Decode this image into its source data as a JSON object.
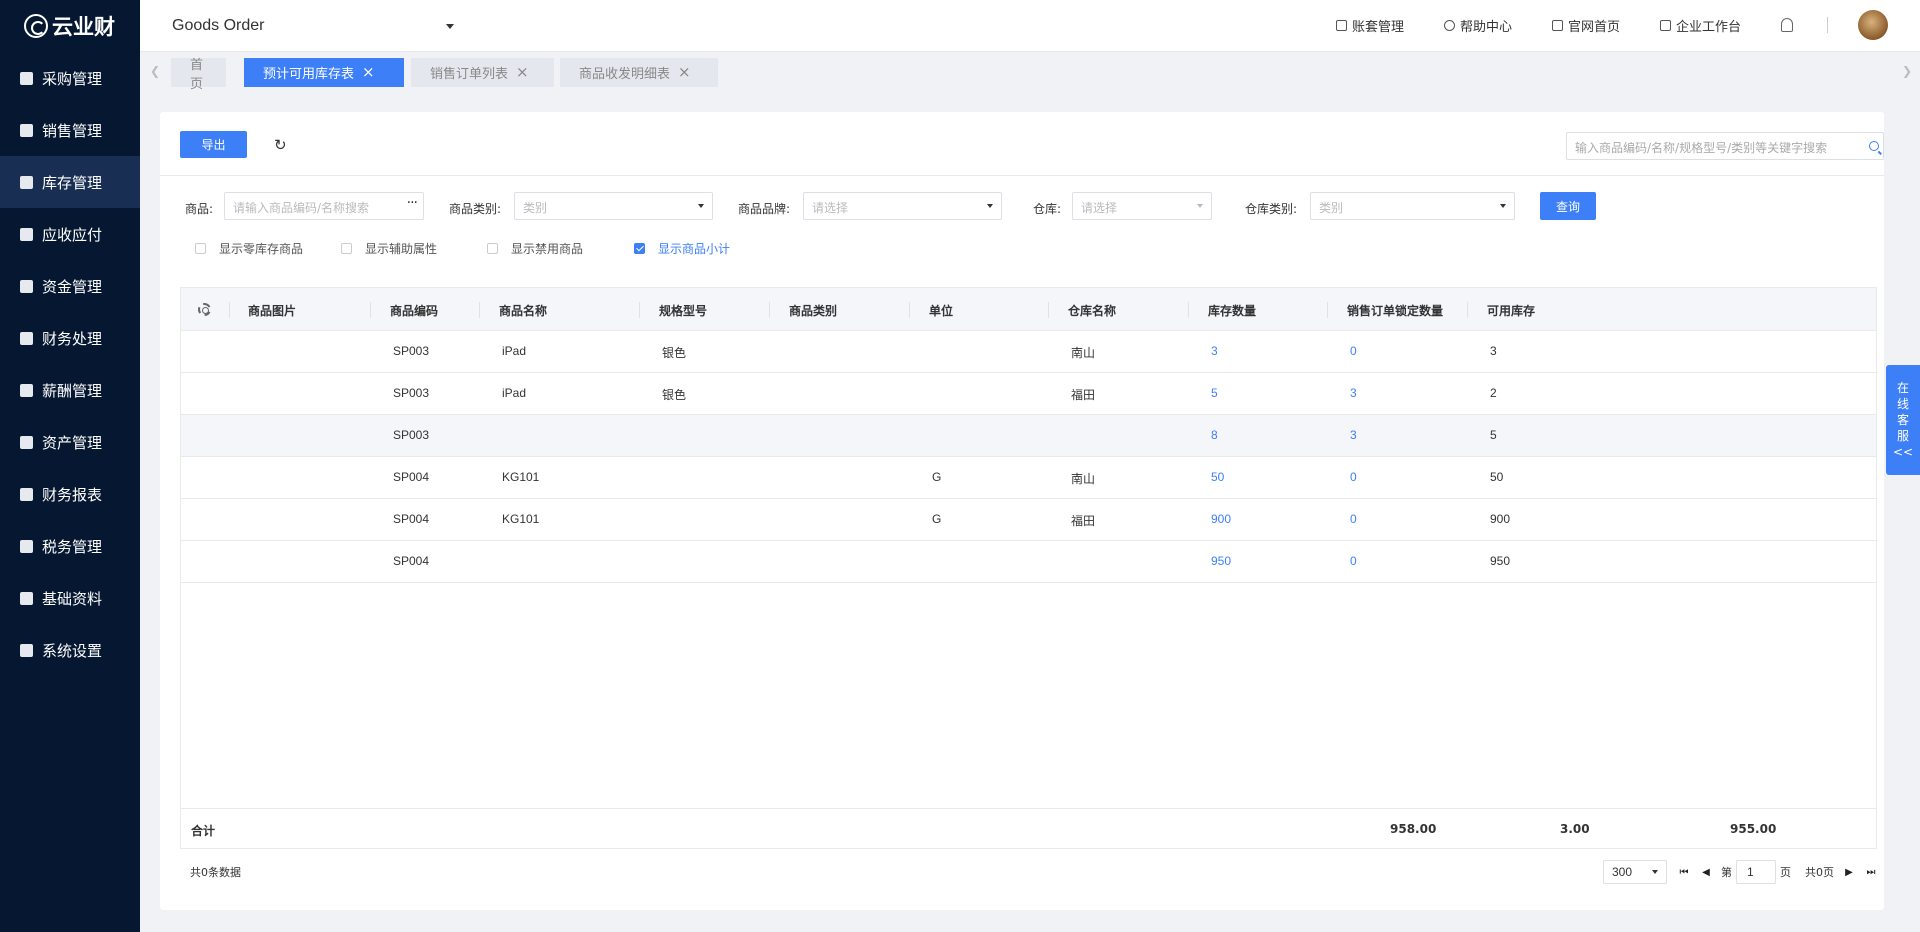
{
  "brand": {
    "name": "云业财"
  },
  "sidebar": {
    "items": [
      {
        "label": "采购管理",
        "icon": "bag-icon"
      },
      {
        "label": "销售管理",
        "icon": "tag-icon"
      },
      {
        "label": "库存管理",
        "icon": "warehouse-icon",
        "active": true
      },
      {
        "label": "应收应付",
        "icon": "yen-icon"
      },
      {
        "label": "资金管理",
        "icon": "fund-icon"
      },
      {
        "label": "财务处理",
        "icon": "finance-icon"
      },
      {
        "label": "薪酬管理",
        "icon": "user-pay-icon"
      },
      {
        "label": "资产管理",
        "icon": "chart-icon"
      },
      {
        "label": "财务报表",
        "icon": "report-icon"
      },
      {
        "label": "税务管理",
        "icon": "percent-icon"
      },
      {
        "label": "基础资料",
        "icon": "layers-icon"
      },
      {
        "label": "系统设置",
        "icon": "gear-icon"
      }
    ]
  },
  "header": {
    "app_title": "Goods Order",
    "links": [
      {
        "label": "账套管理",
        "icon": "ledger-icon"
      },
      {
        "label": "帮助中心",
        "icon": "help-icon"
      },
      {
        "label": "官网首页",
        "icon": "home-icon"
      },
      {
        "label": "企业工作台",
        "icon": "monitor-icon"
      }
    ]
  },
  "tabs": [
    {
      "label": "首页",
      "closable": false,
      "active": false
    },
    {
      "label": "预计可用库存表",
      "closable": true,
      "active": true
    },
    {
      "label": "销售订单列表",
      "closable": true,
      "active": false
    },
    {
      "label": "商品收发明细表",
      "closable": true,
      "active": false
    }
  ],
  "toolbar": {
    "export_label": "导出",
    "search_placeholder": "输入商品编码/名称/规格型号/类别等关键字搜索"
  },
  "filters": {
    "goods_label": "商品:",
    "goods_placeholder": "请输入商品编码/名称搜索",
    "category_label": "商品类别:",
    "category_placeholder": "类别",
    "brand_label": "商品品牌:",
    "brand_placeholder": "请选择",
    "warehouse_label": "仓库:",
    "warehouse_placeholder": "请选择",
    "warehouse_type_label": "仓库类别:",
    "warehouse_type_placeholder": "类别",
    "query_label": "查询"
  },
  "options": [
    {
      "label": "显示零库存商品",
      "checked": false
    },
    {
      "label": "显示辅助属性",
      "checked": false
    },
    {
      "label": "显示禁用商品",
      "checked": false
    },
    {
      "label": "显示商品小计",
      "checked": true
    }
  ],
  "table": {
    "columns": [
      "商品图片",
      "商品编码",
      "商品名称",
      "规格型号",
      "商品类别",
      "单位",
      "仓库名称",
      "库存数量",
      "销售订单锁定数量",
      "可用库存"
    ],
    "rows": [
      {
        "code": "SP003",
        "name": "iPad",
        "spec": "银色",
        "category": "",
        "unit": "",
        "warehouse": "南山",
        "stock": "3",
        "locked": "0",
        "available": "3",
        "subtotal": false
      },
      {
        "code": "SP003",
        "name": "iPad",
        "spec": "银色",
        "category": "",
        "unit": "",
        "warehouse": "福田",
        "stock": "5",
        "locked": "3",
        "available": "2",
        "subtotal": false
      },
      {
        "code": "SP003",
        "name": "",
        "spec": "",
        "category": "",
        "unit": "",
        "warehouse": "",
        "stock": "8",
        "locked": "3",
        "available": "5",
        "subtotal": true
      },
      {
        "code": "SP004",
        "name": "KG101",
        "spec": "",
        "category": "",
        "unit": "G",
        "warehouse": "南山",
        "stock": "50",
        "locked": "0",
        "available": "50",
        "subtotal": false
      },
      {
        "code": "SP004",
        "name": "KG101",
        "spec": "",
        "category": "",
        "unit": "G",
        "warehouse": "福田",
        "stock": "900",
        "locked": "0",
        "available": "900",
        "subtotal": false
      },
      {
        "code": "SP004",
        "name": "",
        "spec": "",
        "category": "",
        "unit": "",
        "warehouse": "",
        "stock": "950",
        "locked": "0",
        "available": "950",
        "subtotal": false
      }
    ],
    "footer": {
      "label": "合计",
      "stock": "958.00",
      "locked": "3.00",
      "available": "955.00"
    }
  },
  "pagination": {
    "total_text": "共0条数据",
    "page_size": "300",
    "page_prefix": "第",
    "page": "1",
    "page_suffix": "页",
    "total_pages": "共0页"
  },
  "service": {
    "label_chars": [
      "在",
      "线",
      "客",
      "服",
      "<<"
    ]
  },
  "colors": {
    "sidebar_bg": "#061831",
    "sidebar_active": "#182e52",
    "primary": "#3d7ff6"
  }
}
